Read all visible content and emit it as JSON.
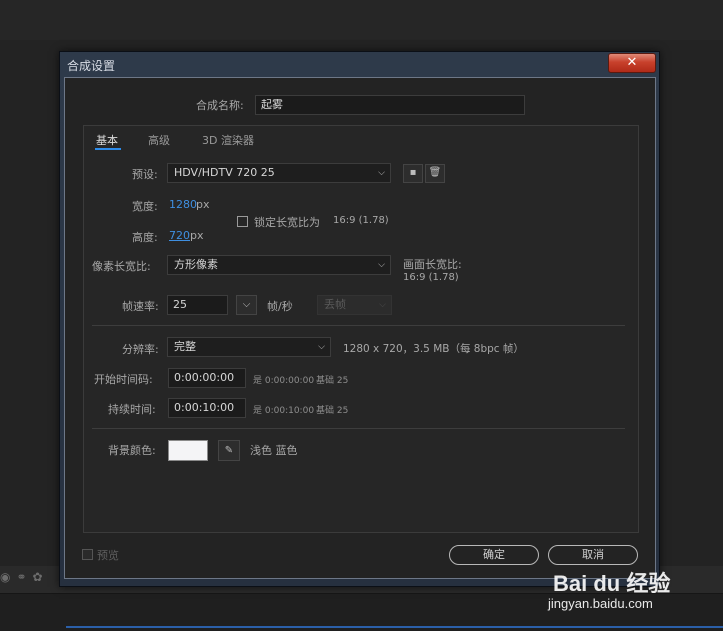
{
  "dialog": {
    "title": "合成设置",
    "close_label": "✕"
  },
  "comp_name": {
    "label": "合成名称:",
    "value": "起雾"
  },
  "tabs": [
    {
      "label": "基本"
    },
    {
      "label": "高级"
    },
    {
      "label": "3D 渲染器"
    }
  ],
  "preset": {
    "label": "预设:",
    "value": "HDV/HDTV 720 25"
  },
  "width": {
    "label": "宽度:",
    "value": "1280",
    "unit": "px"
  },
  "height": {
    "label": "高度:",
    "value": "720",
    "unit": "px"
  },
  "lock_aspect": {
    "label": "锁定长宽比为",
    "ratio": "16:9 (1.78)",
    "checked": false
  },
  "pixel_aspect": {
    "label": "像素长宽比:",
    "value": "方形像素"
  },
  "frame_aspect": {
    "label": "画面长宽比:",
    "value": "16:9 (1.78)"
  },
  "frame_rate": {
    "label": "帧速率:",
    "value": "25",
    "unit": "帧/秒",
    "drop_frame": "丢帧"
  },
  "resolution": {
    "label": "分辨率:",
    "value": "完整",
    "info": "1280 x 720，3.5 MB（每 8bpc 帧）"
  },
  "start_timecode": {
    "label": "开始时间码:",
    "value": "0:00:00:00",
    "is_text": "是 0:00:00:00",
    "base_text": "基础 25"
  },
  "duration": {
    "label": "持续时间:",
    "value": "0:00:10:00",
    "is_text": "是 0:00:10:00",
    "base_text": "基础 25"
  },
  "background": {
    "label": "背景颜色:",
    "color_name": "浅色 蓝色",
    "color": "#F4F4F6"
  },
  "footer": {
    "preview_label": "预览",
    "ok_label": "确定",
    "cancel_label": "取消"
  },
  "watermark": {
    "brand": "Bai du 经验",
    "url": "jingyan.baidu.com"
  },
  "colors": {
    "accent": "#2D8CEB",
    "link": "#3F8FE0",
    "close": "#C8412C"
  }
}
